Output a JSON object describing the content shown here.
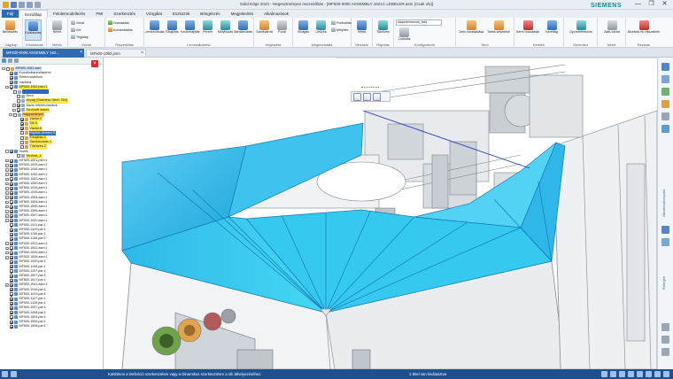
{
  "window": {
    "title": "Solid Edge 2023 - Hegesztményes összeállítás - [MF500-0000 ASSEMBLY 1621C LEBELER.asm (Csak olv)]",
    "brand": "SIEMENS",
    "controls": [
      "—",
      "❐",
      "✕"
    ]
  },
  "ribbon": {
    "tabs": [
      "Fájl",
      "Kezdőlap",
      "Felületmodellezés",
      "PMI",
      "Szerkesztés",
      "Vizsgálat",
      "Eszközök",
      "Böngészés",
      "Megjelenítés",
      "Alkalmazások"
    ],
    "active_tab": "Kezdőlap",
    "groups": [
      {
        "label": "Vágólap",
        "buttons": [
          "Beillesztés"
        ]
      },
      {
        "label": "Kiválasztás",
        "buttons": [
          "Kiválasztás"
        ]
      },
      {
        "label": "Mérés",
        "buttons": [
          "Nézet"
        ]
      },
      {
        "label": "Vázlat",
        "small": [
          "Vonal",
          "Kör",
          "Téglalap",
          "Ív"
        ]
      },
      {
        "label": "Összeállítás",
        "small": [
          "Hozzáadás",
          "Konstruktálás"
        ]
      },
      {
        "label": "Lemezalkatrész",
        "buttons": [
          "Lemezvidulás",
          "Élhajlítás",
          "Kontúrhajlítás",
          "Perem",
          "Mélyhúzás",
          "Saroklezárás"
        ]
      },
      {
        "label": "Hegesztés",
        "buttons": [
          "Sarokvarrat",
          "Furat"
        ]
      },
      {
        "label": "Megmunkálás",
        "buttons": [
          "Kivágás",
          "Letörés"
        ],
        "small": [
          "Pontosítás",
          "Mélyítés"
        ]
      },
      {
        "label": "Mintázat",
        "buttons": [
          "Minta"
        ]
      },
      {
        "label": "Rajzolás",
        "buttons": [
          "Tükrözés"
        ]
      },
      {
        "label": "Konfigurációk",
        "combo": "alapértelmezett_felül",
        "buttons": [
          "Csatolás"
        ]
      },
      {
        "label": "Tartó",
        "buttons": [
          "Tartó hozzáadása",
          "Tartók készítése"
        ]
      },
      {
        "label": "Keretek",
        "buttons": [
          "Keret hozzáadása",
          "Kerettag"
        ]
      },
      {
        "label": "Generátor",
        "buttons": [
          "Gyorsreferencia"
        ]
      },
      {
        "label": "Nézet",
        "buttons": [
          "Alak-vázlat"
        ]
      },
      {
        "label": "Bezárás",
        "buttons": [
          "Bezárás és visszatérés"
        ]
      }
    ]
  },
  "doc_tabs": [
    {
      "label": "MF500-0000 ASSEMBLY 162...",
      "active": true
    },
    {
      "label": "MF500-1062.psm",
      "active": false
    }
  ],
  "pathfinder": {
    "nodes": [
      {
        "text": "MF500-1062.asm",
        "level": 0,
        "hl": "lb",
        "check": false,
        "exp": "-"
      },
      {
        "text": "Koordinátarendszerek",
        "level": 1,
        "hl": "",
        "check": true,
        "exp": ""
      },
      {
        "text": "Referenciasíkok",
        "level": 1,
        "hl": "",
        "check": true,
        "exp": ""
      },
      {
        "text": "Vázlatok",
        "level": 1,
        "hl": "",
        "check": true,
        "exp": ""
      },
      {
        "text": "MF500-1062.psm:1",
        "level": 1,
        "hl": "y",
        "check": true,
        "exp": "-"
      },
      {
        "text": "",
        "level": 2,
        "hl": "b",
        "check": false,
        "exp": ""
      },
      {
        "text": "Bevo",
        "level": 3,
        "hl": "",
        "check": false,
        "exp": ""
      },
      {
        "text": "Anyag (Stainless Steel, 304)",
        "level": 3,
        "hl": "y",
        "check": false,
        "exp": ""
      },
      {
        "text": "Bázis referenciasíkok",
        "level": 3,
        "hl": "",
        "check": true,
        "exp": "+"
      },
      {
        "text": "Tervezett testek",
        "level": 3,
        "hl": "y",
        "check": true,
        "exp": "+"
      },
      {
        "text": "Hagyományos",
        "level": 2,
        "hl": "o",
        "check": false,
        "exp": "-"
      },
      {
        "text": "Vázlat 4",
        "level": 4,
        "hl": "y",
        "check": true,
        "exp": ""
      },
      {
        "text": "Sík 5",
        "level": 4,
        "hl": "y",
        "check": true,
        "exp": ""
      },
      {
        "text": "Vázlat 5",
        "level": 4,
        "hl": "y",
        "check": true,
        "exp": ""
      },
      {
        "text": "Hajlítás (lemez) 5",
        "level": 4,
        "hl": "b",
        "check": false,
        "exp": ""
      },
      {
        "text": "Élhajlítás 5",
        "level": 4,
        "hl": "y",
        "check": false,
        "exp": ""
      },
      {
        "text": "Saroklezárás 1",
        "level": 4,
        "hl": "y",
        "check": false,
        "exp": ""
      },
      {
        "text": "Tükrözés 2",
        "level": 4,
        "hl": "y",
        "check": false,
        "exp": ""
      },
      {
        "text": "Testek",
        "level": 1,
        "hl": "",
        "check": true,
        "exp": "-"
      },
      {
        "text": "Tervtest_4",
        "level": 3,
        "hl": "y",
        "check": false,
        "exp": ""
      },
      {
        "text": "MF500-1001.psm:1",
        "level": 1,
        "hl": "",
        "check": true,
        "exp": "+"
      },
      {
        "text": "MF500-1525.asm:1",
        "level": 1,
        "hl": "",
        "check": true,
        "exp": "+"
      },
      {
        "text": "MF500-1048.asm:1",
        "level": 1,
        "hl": "",
        "check": true,
        "exp": "+"
      },
      {
        "text": "MF500-1052.asm:1",
        "level": 1,
        "hl": "",
        "check": true,
        "exp": "+"
      },
      {
        "text": "MF500-1053.asm:1",
        "level": 1,
        "hl": "",
        "check": true,
        "exp": "+"
      },
      {
        "text": "MF500-1050.asm:1",
        "level": 1,
        "hl": "",
        "check": true,
        "exp": "+"
      },
      {
        "text": "MF500-1026.asm:1",
        "level": 1,
        "hl": "",
        "check": true,
        "exp": "+"
      },
      {
        "text": "MF500-1028.asm:1",
        "level": 1,
        "hl": "",
        "check": true,
        "exp": "+"
      },
      {
        "text": "MF500-1554.asm:1",
        "level": 1,
        "hl": "",
        "check": true,
        "exp": "+"
      },
      {
        "text": "MF500-1594.asm:1",
        "level": 1,
        "hl": "",
        "check": true,
        "exp": "+"
      },
      {
        "text": "MF500-1595.asm:1",
        "level": 1,
        "hl": "",
        "check": true,
        "exp": "+"
      },
      {
        "text": "MF500-1596.asm:1",
        "level": 1,
        "hl": "",
        "check": true,
        "exp": "+"
      },
      {
        "text": "MF500-1597.asm:1",
        "level": 1,
        "hl": "",
        "check": true,
        "exp": "+"
      },
      {
        "text": "MF500-1020.asm:1",
        "level": 1,
        "hl": "",
        "check": true,
        "exp": "+"
      },
      {
        "text": "MF500-1411.par:1",
        "level": 1,
        "hl": "",
        "check": true,
        "exp": ""
      },
      {
        "text": "MF500-1429.par:1",
        "level": 1,
        "hl": "",
        "check": true,
        "exp": ""
      },
      {
        "text": "MF500-1155.par:1",
        "level": 1,
        "hl": "",
        "check": true,
        "exp": ""
      },
      {
        "text": "MF500-1158.par:2",
        "level": 1,
        "hl": "",
        "check": true,
        "exp": ""
      },
      {
        "text": "MF500-1533.asm:1",
        "level": 1,
        "hl": "",
        "check": true,
        "exp": "+"
      },
      {
        "text": "MF500-1542.asm:1",
        "level": 1,
        "hl": "",
        "check": true,
        "exp": "+"
      },
      {
        "text": "MF500-1526.asm:1",
        "level": 1,
        "hl": "",
        "check": true,
        "exp": "+"
      },
      {
        "text": "MF500-1528.asm:1",
        "level": 1,
        "hl": "",
        "check": true,
        "exp": "+"
      },
      {
        "text": "MF500-1530.par:1",
        "level": 1,
        "hl": "",
        "check": true,
        "exp": ""
      },
      {
        "text": "MF500-1108.par:1",
        "level": 1,
        "hl": "",
        "check": true,
        "exp": ""
      },
      {
        "text": "MF500-1157.par:1",
        "level": 1,
        "hl": "",
        "check": true,
        "exp": ""
      },
      {
        "text": "MF500-1507.par:1",
        "level": 1,
        "hl": "",
        "check": true,
        "exp": ""
      },
      {
        "text": "MF500-1617.par:1",
        "level": 1,
        "hl": "",
        "check": true,
        "exp": ""
      },
      {
        "text": "MF500-1041.asm:1",
        "level": 1,
        "hl": "",
        "check": true,
        "exp": "+"
      },
      {
        "text": "MF500-1016.par:1",
        "level": 1,
        "hl": "",
        "check": true,
        "exp": ""
      },
      {
        "text": "MF500-1019.par:1",
        "level": 1,
        "hl": "",
        "check": true,
        "exp": ""
      },
      {
        "text": "MF500-1127.par:1",
        "level": 1,
        "hl": "",
        "check": true,
        "exp": ""
      },
      {
        "text": "MF500-1128.par:1",
        "level": 1,
        "hl": "",
        "check": true,
        "exp": ""
      },
      {
        "text": "MF500-1097.par:1",
        "level": 1,
        "hl": "",
        "check": true,
        "exp": ""
      },
      {
        "text": "MF500-1098.par:1",
        "level": 1,
        "hl": "",
        "check": true,
        "exp": ""
      },
      {
        "text": "MF500-1504.par:1",
        "level": 1,
        "hl": "",
        "check": true,
        "exp": ""
      },
      {
        "text": "MF500-1506.par:1",
        "level": 1,
        "hl": "",
        "check": true,
        "exp": ""
      },
      {
        "text": "MF500-1508.par:1",
        "level": 1,
        "hl": "",
        "check": true,
        "exp": ""
      }
    ]
  },
  "right_bar": {
    "labels": [
      "Alkatrészkönyvtár",
      "Rétegek"
    ]
  },
  "status": {
    "message": "Kattintson a Definíció szerkesztésre vagy a Dinamikus szerkesztésre a sík áthelyezéséhez.",
    "selection": "1 tétel van kiválasztva"
  },
  "colors": {
    "accent": "#2f6bb5",
    "highlight_yellow": "#ffe94f",
    "highlight_orange": "#ffc04a",
    "sheet_metal": "#2fb8ea",
    "status_bar": "#1f4f8c",
    "siemens_teal": "#0a8a96"
  }
}
